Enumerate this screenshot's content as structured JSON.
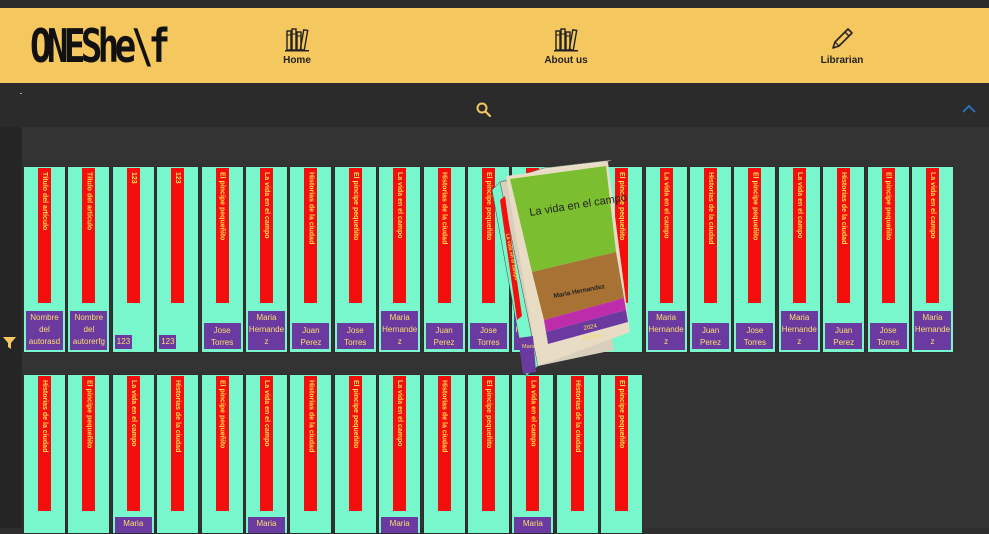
{
  "header": {
    "logo": "ONEShe\\f",
    "nav": [
      {
        "label": "Home",
        "icon": "books-icon"
      },
      {
        "label": "About us",
        "icon": "books-icon"
      },
      {
        "label": "Librarian",
        "icon": "pencil-icon"
      }
    ]
  },
  "colors": {
    "header_bg": "#f4c75f",
    "book_bg": "#78f6cc",
    "spine": "#f40e0e",
    "spine_text": "#f7e24a",
    "author_bg": "#6b3aa0",
    "accent": "#f4c75f"
  },
  "shelf": {
    "row1": [
      {
        "title": "Título del artículo",
        "author": "Nombre del autorasd"
      },
      {
        "title": "Título del artículo",
        "author": "Nombre del autorerfg"
      },
      {
        "title": "123",
        "author": "123"
      },
      {
        "title": "123",
        "author": "123"
      },
      {
        "title": "El pincipe pequeñito",
        "author": "Jose Torres"
      },
      {
        "title": "La vida en el campo",
        "author": "Maria Hernande z"
      },
      {
        "title": "Historias de la ciudad",
        "author": "Juan Perez"
      },
      {
        "title": "El pincipe pequeñito",
        "author": "Jose Torres"
      },
      {
        "title": "La vida en el campo",
        "author": "Maria Hernande z"
      },
      {
        "title": "Historias de la ciudad",
        "author": "Juan Perez"
      },
      {
        "title": "El pincipe pequeñito",
        "author": "Jose Torres"
      },
      {
        "title": "La vida en el campo",
        "author": "Maria Hernande z"
      },
      {
        "title": "Historias de la ciudad",
        "author": ""
      },
      {
        "title": "El pincipe pequeñito",
        "author": ""
      },
      {
        "title": "La vida en el campo",
        "author": "Maria Hernande z"
      },
      {
        "title": "Historias de la ciudad",
        "author": "Juan Perez"
      },
      {
        "title": "El pincipe pequeñito",
        "author": "Jose Torres"
      },
      {
        "title": "La vida en el campo",
        "author": "Maria Hernande z"
      },
      {
        "title": "Historias de la ciudad",
        "author": "Juan Perez"
      },
      {
        "title": "El pincipe pequeñito",
        "author": "Jose Torres"
      },
      {
        "title": "La vida en el campo",
        "author": "Maria Hernande z"
      }
    ],
    "row2": [
      {
        "title": "Historias de la ciudad",
        "author": ""
      },
      {
        "title": "El pincipe pequeñito",
        "author": ""
      },
      {
        "title": "La vida en el campo",
        "author": "Maria"
      },
      {
        "title": "Historias de la ciudad",
        "author": ""
      },
      {
        "title": "El pincipe pequeñito",
        "author": ""
      },
      {
        "title": "La vida en el campo",
        "author": "Maria"
      },
      {
        "title": "Historias de la ciudad",
        "author": ""
      },
      {
        "title": "El pincipe pequeñito",
        "author": ""
      },
      {
        "title": "La vida en el campo",
        "author": "Maria"
      },
      {
        "title": "Historias de la ciudad",
        "author": ""
      },
      {
        "title": "El pincipe pequeñito",
        "author": ""
      },
      {
        "title": "La vida en el campo",
        "author": "Maria"
      },
      {
        "title": "Historias de la ciudad",
        "author": ""
      },
      {
        "title": "El pincipe pequeñito",
        "author": ""
      }
    ]
  },
  "featured": {
    "title": "La vida en el campo",
    "author": "Maria Hernandez",
    "year": "2024",
    "extra": "El Pais",
    "spine_author": "Maria Hernande z"
  }
}
